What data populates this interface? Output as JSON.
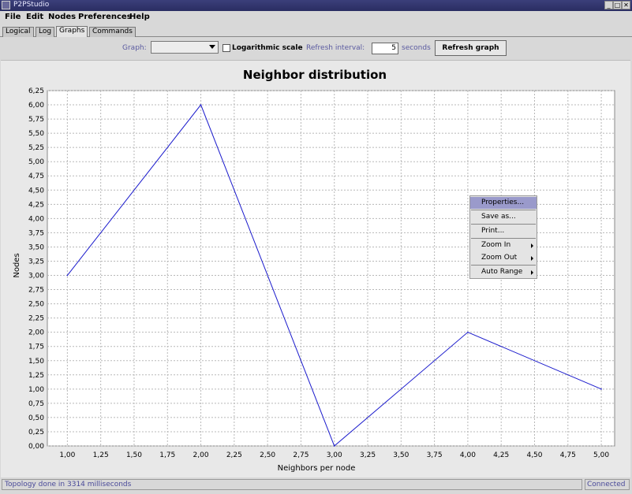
{
  "window": {
    "title": "P2PStudio",
    "minimize": "_",
    "maximize": "□",
    "close": "✕"
  },
  "menubar": {
    "items": [
      "File",
      "Edit",
      "Nodes",
      "Preferences",
      "Help"
    ]
  },
  "tabs": [
    {
      "label": "Logical",
      "active": false
    },
    {
      "label": "Log",
      "active": false
    },
    {
      "label": "Graphs",
      "active": true
    },
    {
      "label": "Commands",
      "active": false
    }
  ],
  "toolbar": {
    "graph_label": "Graph:",
    "graph_value": "",
    "log_scale_label": "Logarithmic scale",
    "log_scale_checked": false,
    "interval_label": "Refresh interval:",
    "interval_value": "5",
    "seconds_label": "seconds",
    "refresh_button": "Refresh graph"
  },
  "chart_data": {
    "type": "line",
    "title": "Neighbor distribution",
    "xlabel": "Neighbors per node",
    "ylabel": "Nodes",
    "x": [
      1,
      2,
      3,
      4,
      5
    ],
    "series": [
      {
        "values": [
          3,
          6,
          0,
          2,
          1
        ],
        "color": "#1a1acc"
      }
    ],
    "xlim": [
      0.85,
      5.1
    ],
    "ylim": [
      0,
      6.25
    ],
    "xticks": [
      "1,00",
      "1,25",
      "1,50",
      "1,75",
      "2,00",
      "2,25",
      "2,50",
      "2,75",
      "3,00",
      "3,25",
      "3,50",
      "3,75",
      "4,00",
      "4,25",
      "4,50",
      "4,75",
      "5,00"
    ],
    "yticks": [
      "0,00",
      "0,25",
      "0,50",
      "0,75",
      "1,00",
      "1,25",
      "1,50",
      "1,75",
      "2,00",
      "2,25",
      "2,50",
      "2,75",
      "3,00",
      "3,25",
      "3,50",
      "3,75",
      "4,00",
      "4,25",
      "4,50",
      "4,75",
      "5,00",
      "5,25",
      "5,50",
      "5,75",
      "6,00",
      "6,25"
    ],
    "grid": true,
    "background": "#ffffff",
    "grid_color": "#b8b8b8"
  },
  "context_menu": {
    "items": [
      {
        "label": "Properties...",
        "highlight": true,
        "submenu": false
      },
      {
        "label": "Save as...",
        "highlight": false,
        "submenu": false
      },
      {
        "label": "Print...",
        "highlight": false,
        "submenu": false
      },
      {
        "label": "Zoom In",
        "highlight": false,
        "submenu": true
      },
      {
        "label": "Zoom Out",
        "highlight": false,
        "submenu": true
      },
      {
        "label": "Auto Range",
        "highlight": false,
        "submenu": true
      }
    ]
  },
  "status": {
    "message": "Topology done in 3314 milliseconds",
    "connection": "Connected"
  }
}
